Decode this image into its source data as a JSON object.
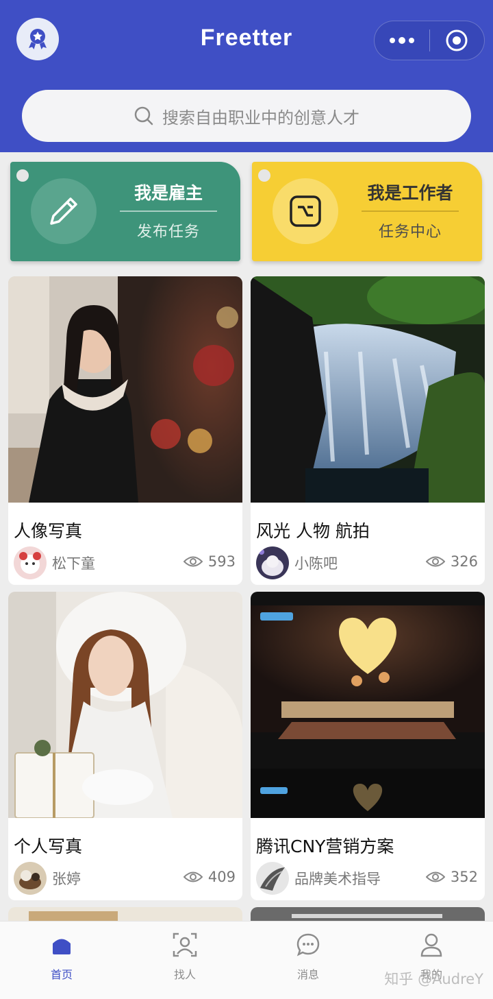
{
  "header": {
    "logo_text": "Freetter",
    "badge_icon": "star-badge-icon",
    "more_icon": "more-dots-icon",
    "close_icon": "target-circle-icon",
    "accent_color": "#3f4fc5"
  },
  "search": {
    "placeholder": "搜索自由职业中的创意人才"
  },
  "roles": [
    {
      "title": "我是雇主",
      "subtitle": "发布任务",
      "icon": "pencil-icon",
      "color": "#3e947a"
    },
    {
      "title": "我是工作者",
      "subtitle": "任务中心",
      "icon": "terminal-icon",
      "color": "#f6ce34"
    }
  ],
  "cards": [
    {
      "title": "人像写真",
      "author": "松下童",
      "views": "593"
    },
    {
      "title": "风光 人物 航拍",
      "author": "小陈吧",
      "views": "326"
    },
    {
      "title": "个人写真",
      "author": "张婷",
      "views": "409"
    },
    {
      "title": "腾讯CNY营销方案",
      "author": "品牌美术指导",
      "views": "352"
    }
  ],
  "tabbar": [
    {
      "label": "首页",
      "icon": "home-icon",
      "active": true
    },
    {
      "label": "找人",
      "icon": "person-search-icon",
      "active": false
    },
    {
      "label": "消息",
      "icon": "chat-bubble-icon",
      "active": false
    },
    {
      "label": "我的",
      "icon": "user-icon",
      "active": false
    }
  ],
  "watermark": "知乎 @AudreY"
}
